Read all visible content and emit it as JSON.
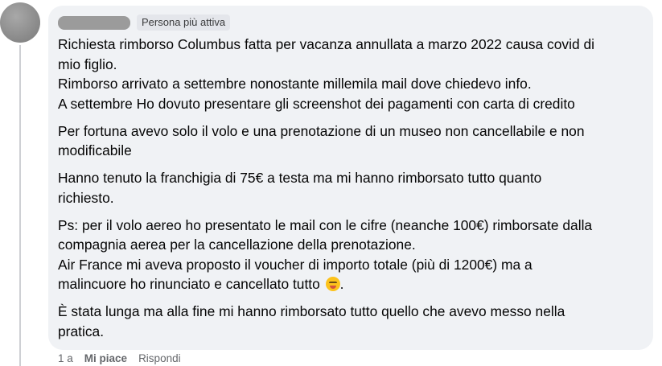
{
  "comment": {
    "badge": "Persona più attiva",
    "paragraphs": [
      [
        "Richiesta rimborso Columbus fatta per vacanza annullata a marzo 2022 causa covid di",
        "mio figlio.",
        "Rimborso arrivato a settembre nonostante millemila mail dove chiedevo info.",
        "A settembre Ho dovuto presentare gli screenshot dei pagamenti con carta di credito"
      ],
      [
        "Per fortuna avevo solo il volo e una prenotazione di un museo non cancellabile e non",
        "modificabile"
      ],
      [
        "Hanno tenuto la franchigia di 75€ a testa ma mi hanno rimborsato tutto quanto",
        "richiesto."
      ],
      [
        "Ps: per il volo aereo ho presentato le mail con le cifre (neanche 100€) rimborsate dalla",
        "compagnia aerea per la cancellazione della prenotazione.",
        "Air France mi aveva proposto il voucher di importo totale (più di 1200€) ma a",
        "malincuore ho rinunciato e cancellato tutto"
      ],
      [
        "È stata lunga ma alla fine mi hanno rimborsato tutto quello che avevo messo nella",
        "pratica."
      ]
    ],
    "end_punct": ".",
    "emoji": "face-with-tear-emoji"
  },
  "actions": {
    "time": "1 a",
    "like": "Mi piace",
    "reply": "Rispondi"
  }
}
